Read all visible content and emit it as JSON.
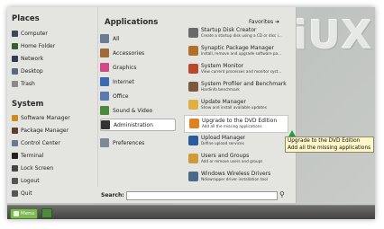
{
  "wallpaper": {
    "text": "iUX"
  },
  "places": {
    "title": "Places",
    "items": [
      {
        "label": "Computer",
        "icon": "computer-icon",
        "color": "#3a4a5a"
      },
      {
        "label": "Home Folder",
        "icon": "home-icon",
        "color": "#35602e"
      },
      {
        "label": "Network",
        "icon": "network-icon",
        "color": "#2d3d52"
      },
      {
        "label": "Desktop",
        "icon": "desktop-icon",
        "color": "#5a6a7a"
      },
      {
        "label": "Trash",
        "icon": "trash-icon",
        "color": "#8a8a8a"
      }
    ]
  },
  "system": {
    "title": "System",
    "items": [
      {
        "label": "Software Manager",
        "icon": "software-manager-icon",
        "color": "#d08a1e"
      },
      {
        "label": "Package Manager",
        "icon": "package-manager-icon",
        "color": "#5a4030"
      },
      {
        "label": "Control Center",
        "icon": "control-center-icon",
        "color": "#6a7a8a"
      },
      {
        "label": "Terminal",
        "icon": "terminal-icon",
        "color": "#222222"
      },
      {
        "label": "Lock Screen",
        "icon": "lock-screen-icon",
        "color": "#444444"
      },
      {
        "label": "Logout",
        "icon": "logout-icon",
        "color": "#555555"
      },
      {
        "label": "Quit",
        "icon": "quit-icon",
        "color": "#555555"
      }
    ]
  },
  "applications": {
    "title": "Applications",
    "favorites_label": "Favorites ➜",
    "categories": [
      {
        "label": "All",
        "icon": "all-icon",
        "color": "#6b7d90"
      },
      {
        "label": "Accessories",
        "icon": "accessories-icon",
        "color": "#a06a3a"
      },
      {
        "label": "Graphics",
        "icon": "graphics-icon",
        "color": "#d04a8a"
      },
      {
        "label": "Internet",
        "icon": "internet-icon",
        "color": "#3a6ab0"
      },
      {
        "label": "Office",
        "icon": "office-icon",
        "color": "#5a7ab0"
      },
      {
        "label": "Sound & Video",
        "icon": "sound-video-icon",
        "color": "#4a8a3a"
      },
      {
        "label": "Administration",
        "icon": "administration-icon",
        "color": "#333333"
      },
      {
        "label": "Preferences",
        "icon": "preferences-icon",
        "color": "#7a8a9a"
      }
    ],
    "selected_category": "Administration",
    "items": [
      {
        "name": "Startup Disk Creator",
        "desc": "Create a startup disk using a CD or disc i...",
        "icon": "startup-disk-icon",
        "color": "#6a6a6a"
      },
      {
        "name": "Synaptic Package Manager",
        "desc": "Install, remove and upgrade software pa...",
        "icon": "synaptic-icon",
        "color": "#b0702a"
      },
      {
        "name": "System Monitor",
        "desc": "View current processes and monitor syst...",
        "icon": "system-monitor-icon",
        "color": "#b84a2a"
      },
      {
        "name": "System Profiler and Benchmark",
        "desc": "Hardinfo benchmark",
        "icon": "profiler-icon",
        "color": "#7a5a3a"
      },
      {
        "name": "Update Manager",
        "desc": "Show and install available updates",
        "icon": "update-manager-icon",
        "color": "#e0b040"
      },
      {
        "name": "Upgrade to the DVD Edition",
        "desc": "Add all the missing applications",
        "icon": "upgrade-dvd-icon",
        "color": "#e08020"
      },
      {
        "name": "Upload Manager",
        "desc": "Define upload services",
        "icon": "upload-manager-icon",
        "color": "#2a5aa0"
      },
      {
        "name": "Users and Groups",
        "desc": "Add or remove users and groups",
        "icon": "users-groups-icon",
        "color": "#d09a3a"
      },
      {
        "name": "Windows Wireless Drivers",
        "desc": "Ndiswrapper driver installation tool",
        "icon": "wireless-icon",
        "color": "#4a6a8a"
      }
    ],
    "highlighted_item": "Upgrade to the DVD Edition"
  },
  "search": {
    "label": "Search:",
    "value": "",
    "icon": "search-icon"
  },
  "tooltip": {
    "line1": "Upgrade to the DVD Edition",
    "line2": "Add all the missing applications"
  },
  "panel": {
    "menu_label": "Menu"
  }
}
